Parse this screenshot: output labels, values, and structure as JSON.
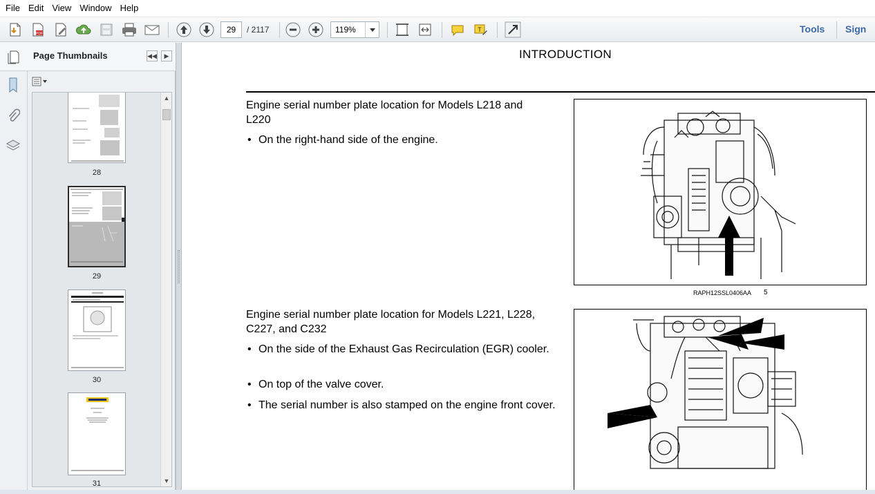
{
  "menu": {
    "items": [
      "File",
      "Edit",
      "View",
      "Window",
      "Help"
    ]
  },
  "toolbar": {
    "current_page": "29",
    "total_pages": "/ 2117",
    "zoom": "119%",
    "tools_label": "Tools",
    "sign_label": "Sign",
    "icons": [
      "create-pdf-icon",
      "export-pdf-icon",
      "edit-icon",
      "upload-icon",
      "save-icon",
      "print-icon",
      "email-icon",
      "previous-page-icon",
      "next-page-icon",
      "zoom-out-icon",
      "zoom-in-icon",
      "fit-page-icon",
      "fit-width-icon",
      "comment-icon",
      "highlight-icon",
      "fullscreen-icon"
    ]
  },
  "panel": {
    "title": "Page Thumbnails",
    "thumbnails": [
      {
        "label": "28"
      },
      {
        "label": "29"
      },
      {
        "label": "30"
      },
      {
        "label": "31"
      }
    ]
  },
  "document": {
    "title": "INTRODUCTION",
    "section1": {
      "heading": "Engine serial number plate location for Models L218 and L220",
      "bullets": [
        "On the right-hand side of the engine."
      ],
      "caption": "RAPH12SSL0406AA",
      "figure_number": "5"
    },
    "section2": {
      "heading": "Engine serial number plate location for Models L221, L228, C227, and C232",
      "bullets": [
        "On the side of the Exhaust Gas Recirculation (EGR) cooler.",
        "On top of the valve cover.",
        "The serial number is also stamped on the engine front cover."
      ]
    }
  },
  "colors": {
    "link": "#3a6aa6",
    "toolbar_bg": "#eceef1",
    "panel_bg": "#eef0f3"
  }
}
